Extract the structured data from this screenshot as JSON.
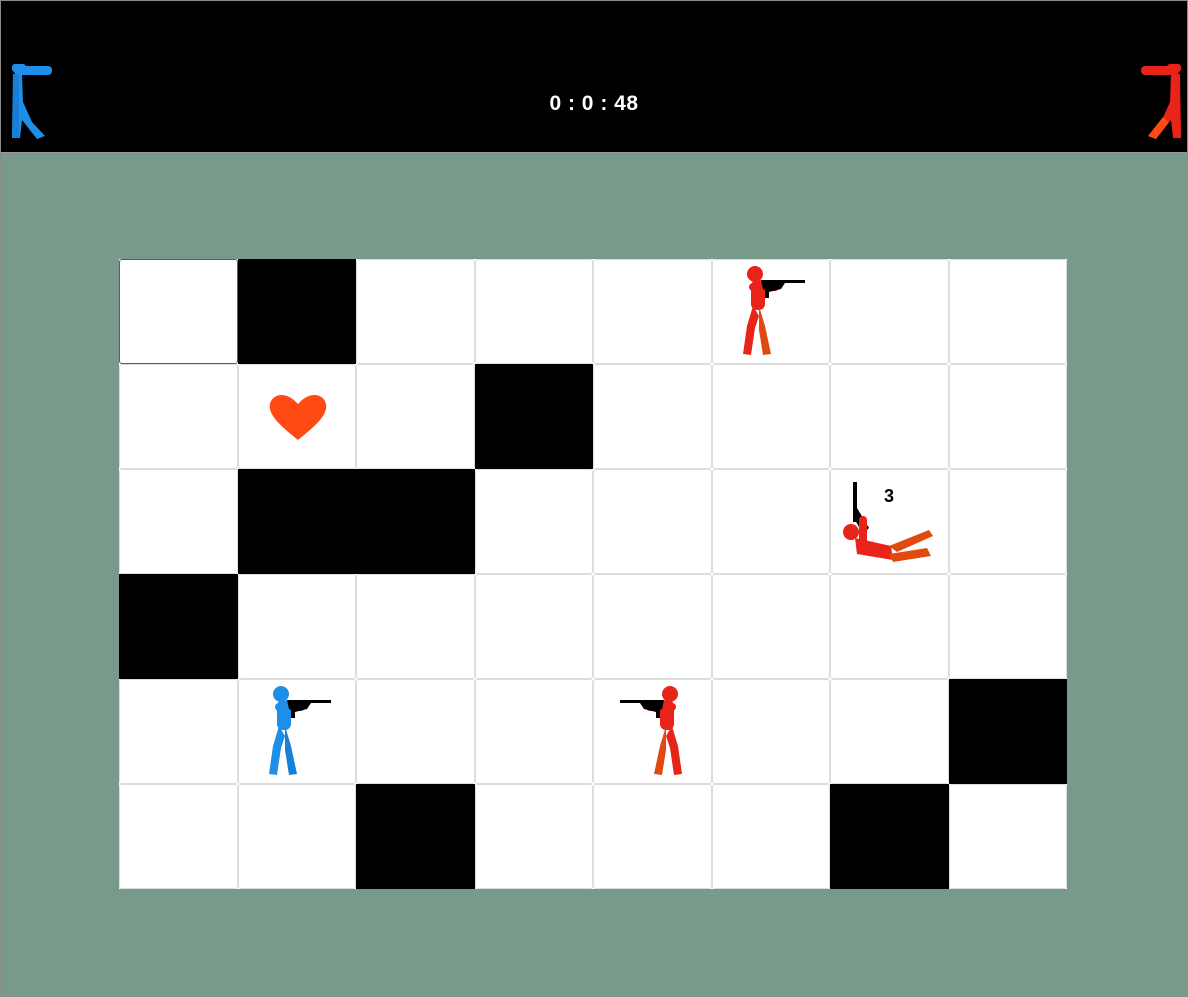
{
  "hud": {
    "timer": "0 : 0 : 48",
    "player_left": {
      "team": "blue",
      "icon": "blue-soldier-icon"
    },
    "player_right": {
      "team": "red",
      "icon": "red-soldier-icon"
    }
  },
  "colors": {
    "background": "#79998a",
    "topbar": "#000000",
    "wall": "#000000",
    "floor": "#ffffff",
    "blue_team": "#1e8fe8",
    "red_team": "#e8231a",
    "heart": "#ff4a14"
  },
  "board": {
    "columns": 8,
    "rows": 6,
    "selected_cell": {
      "row": 0,
      "col": 0
    },
    "walls": [
      {
        "row": 0,
        "col": 1
      },
      {
        "row": 1,
        "col": 3
      },
      {
        "row": 2,
        "col": 1
      },
      {
        "row": 2,
        "col": 2
      },
      {
        "row": 3,
        "col": 0
      },
      {
        "row": 4,
        "col": 7
      },
      {
        "row": 5,
        "col": 2
      },
      {
        "row": 5,
        "col": 6
      }
    ],
    "pieces": [
      {
        "row": 0,
        "col": 5,
        "type": "red-soldier",
        "facing": "right"
      },
      {
        "row": 1,
        "col": 1,
        "type": "heart"
      },
      {
        "row": 2,
        "col": 6,
        "type": "red-soldier-down",
        "badge": "3"
      },
      {
        "row": 4,
        "col": 1,
        "type": "blue-soldier",
        "facing": "right"
      },
      {
        "row": 4,
        "col": 4,
        "type": "red-soldier",
        "facing": "left"
      }
    ]
  }
}
